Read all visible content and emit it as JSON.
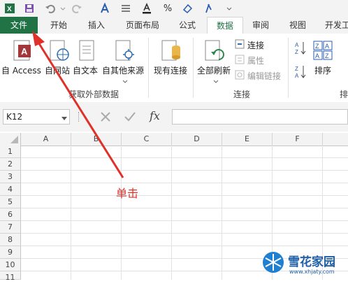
{
  "tabs": {
    "file": "文件",
    "items": [
      "开始",
      "插入",
      "页面布局",
      "公式",
      "数据",
      "审阅",
      "视图",
      "开发工"
    ],
    "active": "数据"
  },
  "ribbon": {
    "get_external": {
      "buttons": [
        "自 Access",
        "自网站",
        "自文本",
        "自其他来源",
        "现有连接"
      ],
      "label": "获取外部数据"
    },
    "connections": {
      "refresh_all": "全部刷新",
      "connections": "连接",
      "properties": "属性",
      "edit_links": "编辑链接",
      "label": "连接"
    },
    "sort": {
      "sort": "排序",
      "label": "排"
    }
  },
  "formula_bar": {
    "name_box": "K12",
    "fx": "fx",
    "value": ""
  },
  "columns": [
    "A",
    "B",
    "C",
    "D",
    "E",
    "F"
  ],
  "rows": [
    "1",
    "2",
    "3",
    "4",
    "5",
    "6",
    "7",
    "8",
    "9",
    "10",
    "11"
  ],
  "annotation": "单击",
  "watermark": {
    "title": "雪花家园",
    "url": "www.xhjaty.com"
  },
  "colors": {
    "excel_green": "#217346",
    "annotation_red": "#e0302a"
  }
}
